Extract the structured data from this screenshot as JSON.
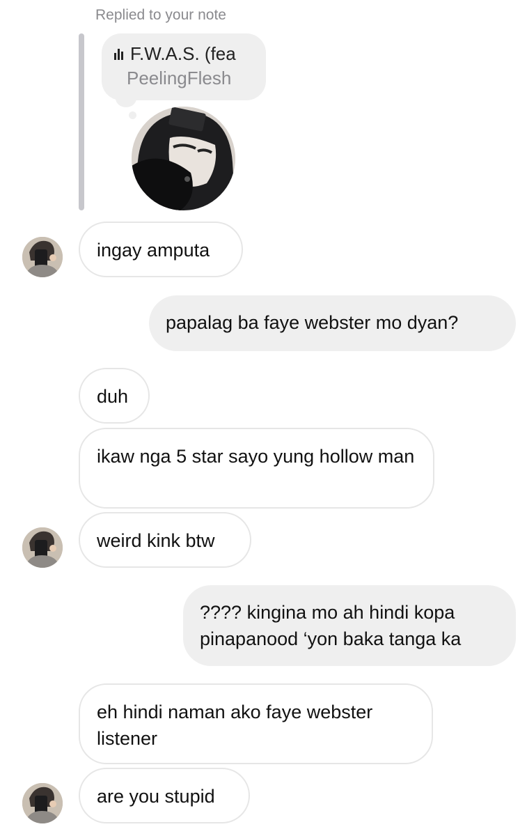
{
  "reply_context": {
    "label": "Replied to your note"
  },
  "note": {
    "song_title": "F.W.A.S. (fea",
    "artist": "PeelingFlesh",
    "icon": "audio-equalizer-icon"
  },
  "messages": [
    {
      "sender": "other",
      "text": "ingay amputa"
    },
    {
      "sender": "me",
      "text": "papalag ba faye webster mo dyan?"
    },
    {
      "sender": "other",
      "text": "duh"
    },
    {
      "sender": "other",
      "text": "ikaw nga 5 star sayo yung hollow man"
    },
    {
      "sender": "other",
      "text": "weird kink btw"
    },
    {
      "sender": "me",
      "text": "???? kingina mo ah hindi kopa pinapanood ‘yon baka tanga ka"
    },
    {
      "sender": "other",
      "text": "eh hindi naman ako faye webster listener"
    },
    {
      "sender": "other",
      "text": "are you stupid"
    }
  ],
  "colors": {
    "incoming_border": "#e6e6e6",
    "outgoing_bubble": "#efefef",
    "secondary_text": "#8a8a8e"
  }
}
